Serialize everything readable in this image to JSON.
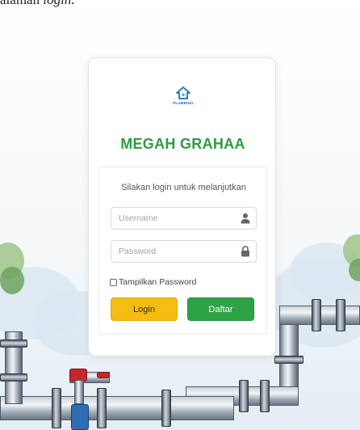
{
  "caption": {
    "prefix": "alaman ",
    "emph": "login."
  },
  "card": {
    "logo_text": "PLUMBING",
    "brand_title": "MEGAH GRAHAA",
    "prompt": "Silakan login untuk melanjutkan",
    "username": {
      "placeholder": "Username",
      "value": ""
    },
    "password": {
      "placeholder": "Password",
      "value": ""
    },
    "show_password_label": "Tampilkan Password",
    "login_label": "Login",
    "register_label": "Daftar"
  },
  "colors": {
    "brand_green": "#2e9a45",
    "login_yellow": "#f5bd12",
    "register_green": "#2ea345",
    "logo_blue": "#1f6fb2"
  }
}
